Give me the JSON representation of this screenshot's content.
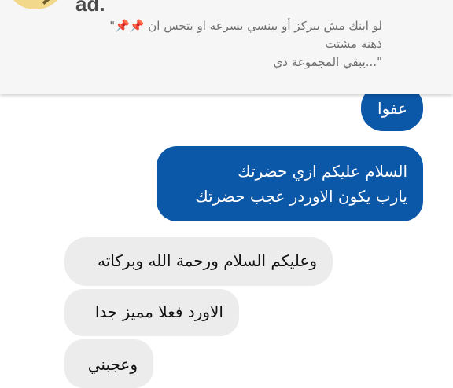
{
  "ad": {
    "title": "ad.",
    "line1_text": "لو ابنك مش بيركز  أو بينسي بسرعه او بتحس ان",
    "line1_open_quote": "\"",
    "line1_emoji": "📌📌",
    "line2": "ذهنه مشتت",
    "line3": "\"...يبقي المجموعة دي"
  },
  "messages": [
    {
      "direction": "outgoing",
      "lines": [
        "عفوا"
      ]
    },
    {
      "direction": "outgoing",
      "lines": [
        "السلام عليكم ازي حضرتك",
        "يارب يكون الاوردر عجب حضرتك"
      ]
    },
    {
      "direction": "incoming",
      "lines": [
        "وعليكم السلام ورحمة الله وبركاته"
      ]
    },
    {
      "direction": "incoming",
      "lines": [
        "الاورد فعلا مميز جدا"
      ]
    },
    {
      "direction": "incoming",
      "lines": [
        "وعجبني"
      ]
    }
  ],
  "colors": {
    "outgoing_bubble": "#0b57a8",
    "incoming_bubble": "#ececec",
    "ad_background": "#f6f6f6"
  }
}
